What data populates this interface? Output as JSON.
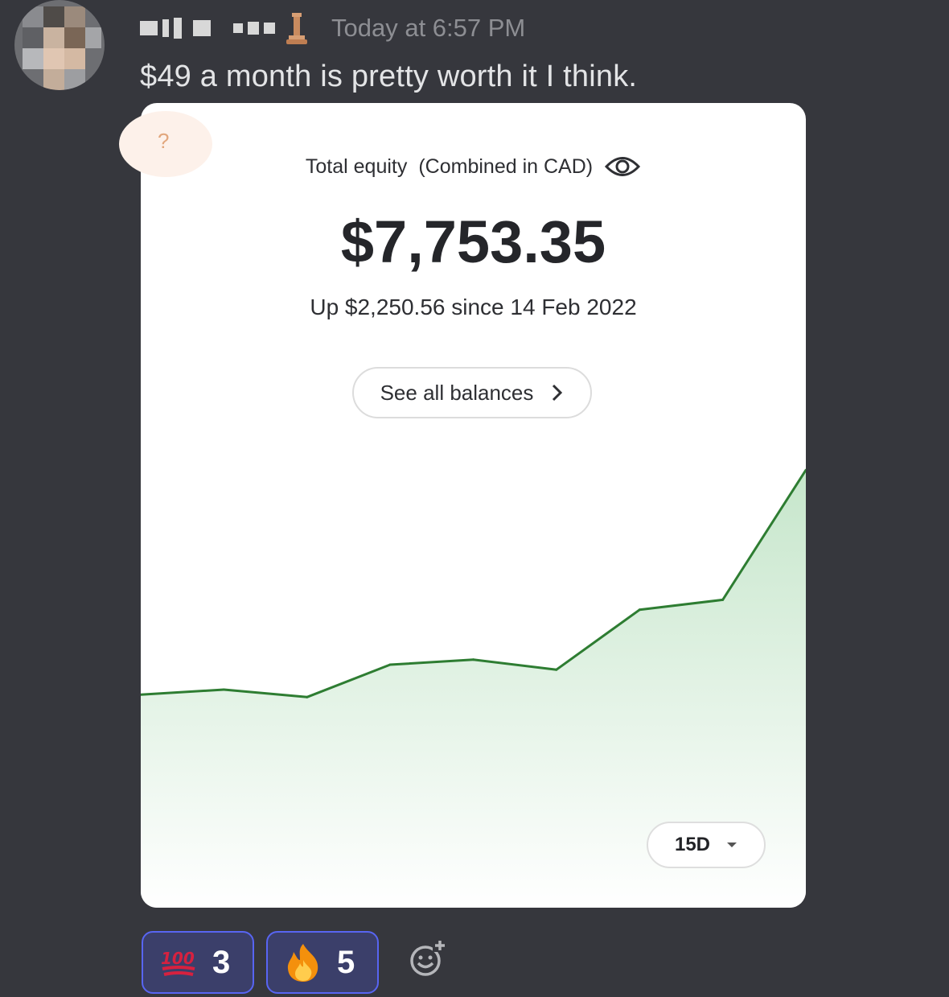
{
  "message": {
    "timestamp": "Today at 6:57 PM",
    "text": "$49 a month is pretty worth it I think."
  },
  "card": {
    "help_symbol": "?",
    "equity_label": "Total equity",
    "equity_combined": "(Combined in CAD)",
    "amount": "$7,753.35",
    "change_text": "Up $2,250.56 since 14 Feb 2022",
    "balances_button": "See all balances",
    "period_selector": "15D",
    "accent_color": "#2e7d32"
  },
  "chart_data": {
    "type": "area",
    "y": [
      0.08,
      0.1,
      0.07,
      0.2,
      0.22,
      0.18,
      0.42,
      0.46,
      0.98
    ],
    "y_description_unit": "relative",
    "grid": false
  },
  "reactions": [
    {
      "icon": "hundred-points-emoji",
      "count": "3"
    },
    {
      "icon": "fire-emoji",
      "count": "5"
    }
  ],
  "icons": {
    "eye": "eye-icon",
    "chevron": "chevron-right-icon",
    "dropdown": "caret-down-icon",
    "add_reaction": "add-reaction-icon",
    "pawn": "chess-pawn-icon"
  }
}
